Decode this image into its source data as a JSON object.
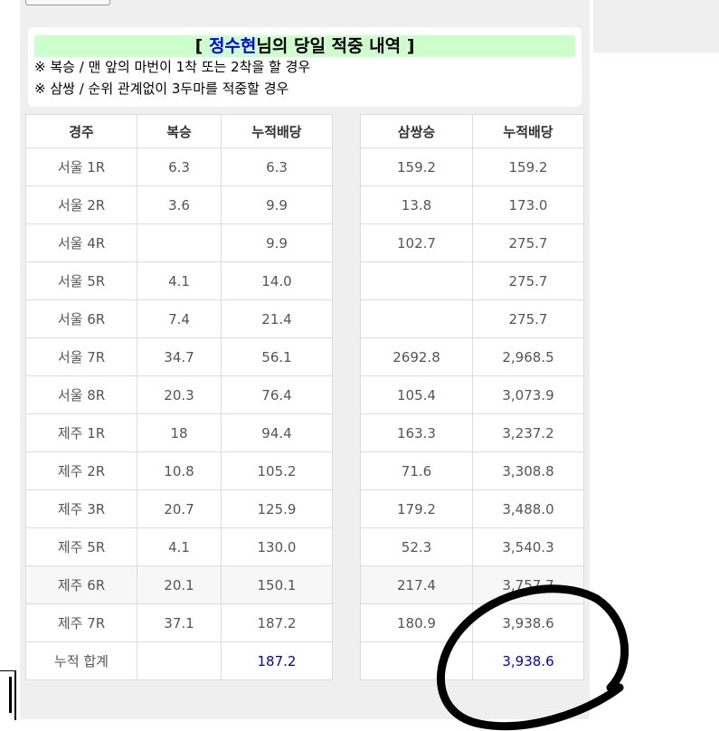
{
  "header": {
    "title_prefix": "[ ",
    "title_name": "정수현",
    "title_suffix": "님의 당일 적중 내역 ]",
    "note_bokseung": "※ 복승 / 맨 앞의 마번이 1착 또는 2착을 할 경우",
    "note_samssang": "※ 삼쌍 / 순위 관계없이 3두마를 적중할 경우"
  },
  "left_table": {
    "headers": [
      "경주",
      "복승",
      "누적배당"
    ],
    "rows": [
      [
        "서울 1R",
        "6.3",
        "6.3"
      ],
      [
        "서울 2R",
        "3.6",
        "9.9"
      ],
      [
        "서울 4R",
        "",
        "9.9"
      ],
      [
        "서울 5R",
        "4.1",
        "14.0"
      ],
      [
        "서울 6R",
        "7.4",
        "21.4"
      ],
      [
        "서울 7R",
        "34.7",
        "56.1"
      ],
      [
        "서울 8R",
        "20.3",
        "76.4"
      ],
      [
        "제주 1R",
        "18",
        "94.4"
      ],
      [
        "제주 2R",
        "10.8",
        "105.2"
      ],
      [
        "제주 3R",
        "20.7",
        "125.9"
      ],
      [
        "제주 5R",
        "4.1",
        "130.0"
      ],
      [
        "제주 6R",
        "20.1",
        "150.1"
      ],
      [
        "제주 7R",
        "37.1",
        "187.2"
      ]
    ],
    "total": [
      "누적 합계",
      "",
      "187.2"
    ]
  },
  "right_table": {
    "headers": [
      "삼쌍승",
      "누적배당"
    ],
    "rows": [
      [
        "159.2",
        "159.2"
      ],
      [
        "13.8",
        "173.0"
      ],
      [
        "102.7",
        "275.7"
      ],
      [
        "",
        "275.7"
      ],
      [
        "",
        "275.7"
      ],
      [
        "2692.8",
        "2,968.5"
      ],
      [
        "105.4",
        "3,073.9"
      ],
      [
        "163.3",
        "3,237.2"
      ],
      [
        "71.6",
        "3,308.8"
      ],
      [
        "179.2",
        "3,488.0"
      ],
      [
        "52.3",
        "3,540.3"
      ],
      [
        "217.4",
        "3,757.7"
      ],
      [
        "180.9",
        "3,938.6"
      ]
    ],
    "total": [
      "",
      "3,938.6"
    ]
  },
  "colors": {
    "title_bg": "#ccffcc",
    "name_color": "#0000ff",
    "total_color": "#0000cc",
    "panel_bg": "#efefef"
  }
}
